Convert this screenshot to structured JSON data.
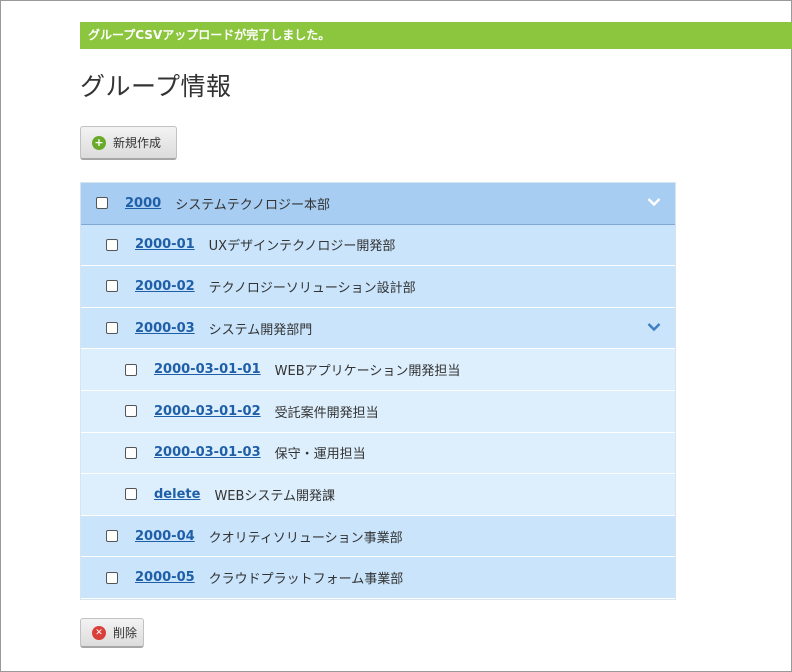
{
  "banner": {
    "message": "グループCSVアップロードが完了しました。"
  },
  "page": {
    "title": "グループ情報"
  },
  "toolbar": {
    "new_label": "新規作成",
    "delete_label": "削除"
  },
  "icons": {
    "new": "plus-circle-icon",
    "delete": "x-circle-icon",
    "expand": "chevron-down-icon"
  },
  "colors": {
    "banner": "#8cc63f",
    "link": "#1f5fa8",
    "row_level0": "#a7cdf2",
    "row_level1": "#c9e4fb",
    "row_level2": "#ddeefc"
  },
  "groups": [
    {
      "code": "2000",
      "name": "システムテクノロジー本部",
      "level": 0,
      "expanded": true
    },
    {
      "code": "2000-01",
      "name": "UXデザインテクノロジー開発部",
      "level": 1
    },
    {
      "code": "2000-02",
      "name": "テクノロジーソリューション設計部",
      "level": 1
    },
    {
      "code": "2000-03",
      "name": "システム開発部門",
      "level": 1,
      "expanded": true
    },
    {
      "code": "2000-03-01-01",
      "name": "WEBアプリケーション開発担当",
      "level": 2
    },
    {
      "code": "2000-03-01-02",
      "name": "受託案件開発担当",
      "level": 2
    },
    {
      "code": "2000-03-01-03",
      "name": "保守・運用担当",
      "level": 2
    },
    {
      "code": "delete",
      "name": "WEBシステム開発課",
      "level": 2
    },
    {
      "code": "2000-04",
      "name": "クオリティソリューション事業部",
      "level": 1
    },
    {
      "code": "2000-05",
      "name": "クラウドプラットフォーム事業部",
      "level": 1
    }
  ]
}
